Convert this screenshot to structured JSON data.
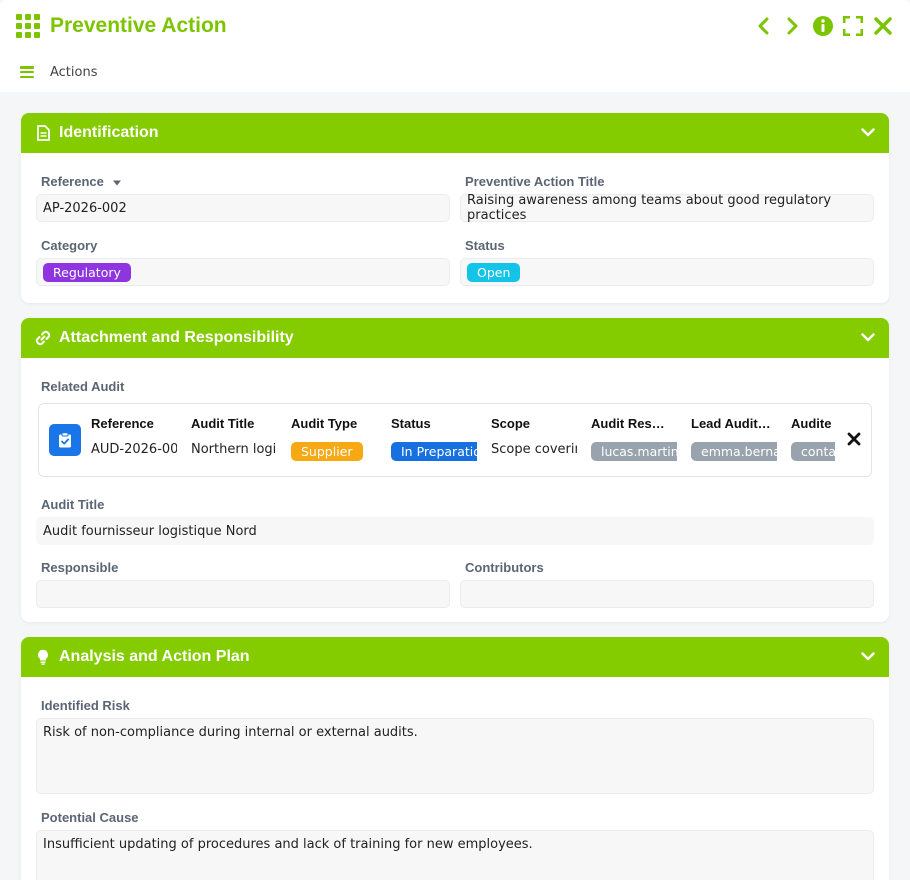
{
  "app": {
    "title": "Preventive Action",
    "menu_label": "Actions"
  },
  "colors": {
    "accent": "#84cc00",
    "title_green": "#7cc400",
    "category_badge": "#8e35e0",
    "status_badge": "#13c4e8",
    "audit_type_badge": "#f6a914",
    "audit_status_badge": "#1670e0",
    "user_chip": "#99a3ad"
  },
  "identification": {
    "header": "Identification",
    "reference_label": "Reference",
    "reference_value": "AP-2026-002",
    "title_label": "Preventive Action Title",
    "title_value": "Raising awareness among teams about good regulatory practices",
    "category_label": "Category",
    "category_value": "Regulatory",
    "status_label": "Status",
    "status_value": "Open"
  },
  "attachment": {
    "header": "Attachment and Responsibility",
    "related_audit_label": "Related Audit",
    "audit_columns": [
      {
        "header": "Reference",
        "value": "AUD-2026-00",
        "kind": "text"
      },
      {
        "header": "Audit Title",
        "value": "Northern logis",
        "kind": "text"
      },
      {
        "header": "Audit Type",
        "value": "Supplier",
        "kind": "badge"
      },
      {
        "header": "Status",
        "value": "In Preparatio",
        "kind": "badge"
      },
      {
        "header": "Scope",
        "value": "Scope coverin",
        "kind": "text"
      },
      {
        "header": "Audit Res…",
        "value": "lucas.martin",
        "kind": "chip"
      },
      {
        "header": "Lead Audit…",
        "value": "emma.berna",
        "kind": "chip"
      },
      {
        "header": "Audite",
        "value": "conta",
        "kind": "chip"
      }
    ],
    "audit_title_label": "Audit Title",
    "audit_title_value": "Audit fournisseur logistique Nord",
    "responsible_label": "Responsible",
    "responsible_value": "",
    "contributors_label": "Contributors",
    "contributors_value": ""
  },
  "analysis": {
    "header": "Analysis and Action Plan",
    "risk_label": "Identified Risk",
    "risk_value": "Risk of non-compliance during internal or external audits.",
    "cause_label": "Potential Cause",
    "cause_value": "Insufficient updating of procedures and lack of training for new employees."
  }
}
